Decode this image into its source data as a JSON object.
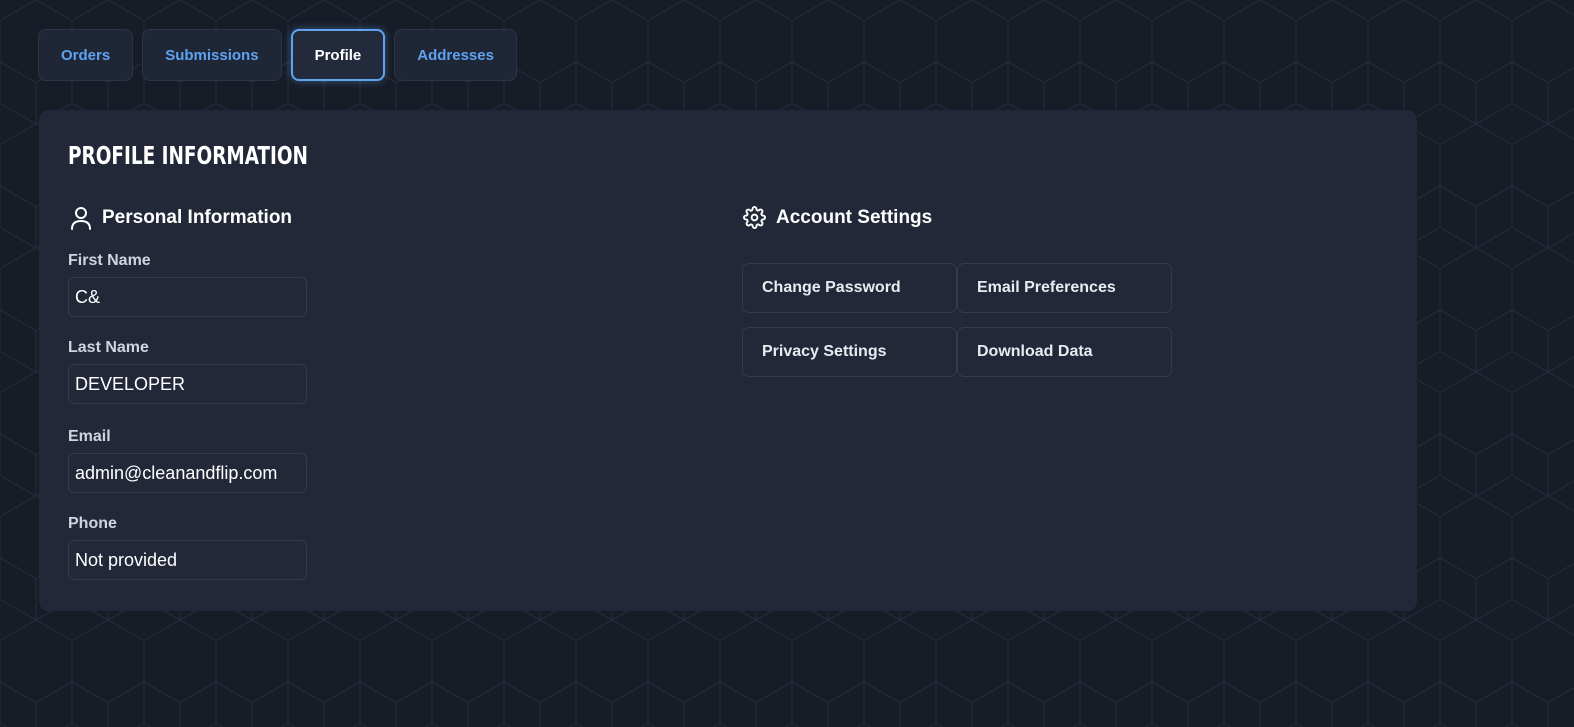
{
  "tabs": [
    {
      "label": "Orders",
      "active": false
    },
    {
      "label": "Submissions",
      "active": false
    },
    {
      "label": "Profile",
      "active": true
    },
    {
      "label": "Addresses",
      "active": false
    }
  ],
  "profile": {
    "title": "PROFILE INFORMATION",
    "personal": {
      "heading": "Personal Information",
      "icon": "user-icon",
      "fields": [
        {
          "label": "First Name",
          "value": "C&"
        },
        {
          "label": "Last Name",
          "value": "DEVELOPER"
        },
        {
          "label": "Email",
          "value": "admin@cleanandflip.com"
        },
        {
          "label": "Phone",
          "value": "Not provided"
        }
      ]
    },
    "account": {
      "heading": "Account Settings",
      "icon": "gear-icon",
      "buttons": [
        {
          "label": "Change Password"
        },
        {
          "label": "Email Preferences"
        },
        {
          "label": "Privacy Settings"
        },
        {
          "label": "Download Data"
        }
      ]
    }
  },
  "colors": {
    "background": "#171c27",
    "panel": "#222837",
    "accent": "#5ea2f2",
    "active_border": "#5fa3f0"
  }
}
